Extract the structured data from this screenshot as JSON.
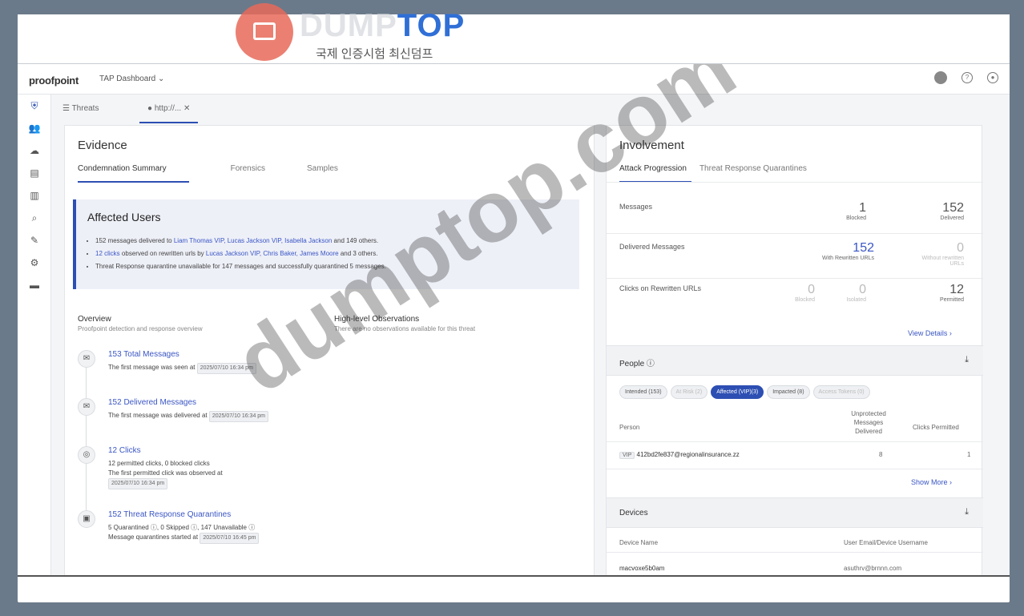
{
  "watermark": {
    "brand_a": "DUMP",
    "brand_b": "TOP",
    "sub": "국제 인증시험 최신덤프",
    "diagonal": "dumptop.com"
  },
  "header": {
    "logo": "proofpoint",
    "dashboard": "TAP Dashboard",
    "dropdown_icon": "chevron-down-icon"
  },
  "rail": {
    "icons": [
      "shield-icon",
      "users-icon",
      "cloud-icon",
      "document-icon",
      "chart-icon",
      "search-icon",
      "wrench-icon",
      "gear-icon",
      "book-icon"
    ]
  },
  "tabs": {
    "threats": "Threats",
    "current": "http://..."
  },
  "evidence": {
    "title": "Evidence",
    "tabs": [
      "Condemnation Summary",
      "Forensics",
      "Samples"
    ],
    "affected": {
      "title": "Affected Users",
      "b1_pre": "152 messages delivered to",
      "b1_users": "Liam Thomas VIP, Lucas Jackson VIP, Isabella Jackson",
      "b1_post": "and 149 others.",
      "b2_link": "12 clicks",
      "b2_mid": "observed on rewritten urls by",
      "b2_users": "Lucas Jackson VIP, Chris Baker, James Moore",
      "b2_post": "and 3 others.",
      "b3": "Threat Response quarantine unavailable for 147 messages and successfully quarantined 5 messages."
    },
    "overview": {
      "title": "Overview",
      "sub": "Proofpoint detection and response overview"
    },
    "observations": {
      "title": "High-level Observations",
      "sub": "There are no observations available for this threat"
    },
    "timeline": [
      {
        "title": "153 Total Messages",
        "line": "The first message was seen at",
        "ts": "2025/07/10 16:34 pm"
      },
      {
        "title": "152 Delivered Messages",
        "line": "The first message was delivered at",
        "ts": "2025/07/10 16:34 pm"
      },
      {
        "title": "12 Clicks",
        "line": "12 permitted clicks, 0 blocked clicks",
        "line2": "The first permitted click was observed at",
        "ts": "2025/07/10 16:34 pm"
      },
      {
        "title": "152 Threat Response Quarantines",
        "line": "5 Quarantined ⓘ, 0 Skipped ⓘ, 147 Unavailable ⓘ",
        "line2": "Message quarantines started at",
        "ts": "2025/07/10 16:45 pm"
      }
    ]
  },
  "involvement": {
    "title": "Involvement",
    "tabs": [
      "Attack Progression",
      "Threat Response Quarantines"
    ],
    "rows": [
      {
        "label": "Messages",
        "a": "1",
        "a_sub": "Blocked",
        "b": "152",
        "b_sub": "Delivered"
      },
      {
        "label": "Delivered Messages",
        "a": "152",
        "a_sub": "With Rewritten URLs",
        "b": "0",
        "b_sub": "Without rewritten URLs"
      },
      {
        "label": "Clicks on Rewritten URLs",
        "a": "0",
        "a_sub": "Blocked",
        "c": "0",
        "c_sub": "Isolated",
        "b": "12",
        "b_sub": "Permitted"
      }
    ],
    "view_details": "View Details ›",
    "people": {
      "title": "People ⓘ",
      "chips": [
        "Intended (153)",
        "At Risk (2)",
        "Affected (VIP)(3)",
        "Impacted (8)",
        "Access Tokens (0)"
      ],
      "col_person": "Person",
      "col_unprot": "Unprotected Messages Delivered",
      "col_clicks": "Clicks Permitted",
      "row": {
        "tag": "VIP",
        "email": "412bd2fe837@regionalinsurance.zz",
        "unprot": "8",
        "clicks": "1"
      },
      "show_more": "Show More ›"
    },
    "devices": {
      "title": "Devices",
      "col_device": "Device Name",
      "col_user": "User Email/Device Username",
      "row": {
        "device": "macvoxe5b0am",
        "user": "asuthrv@brnnn.com"
      }
    }
  }
}
